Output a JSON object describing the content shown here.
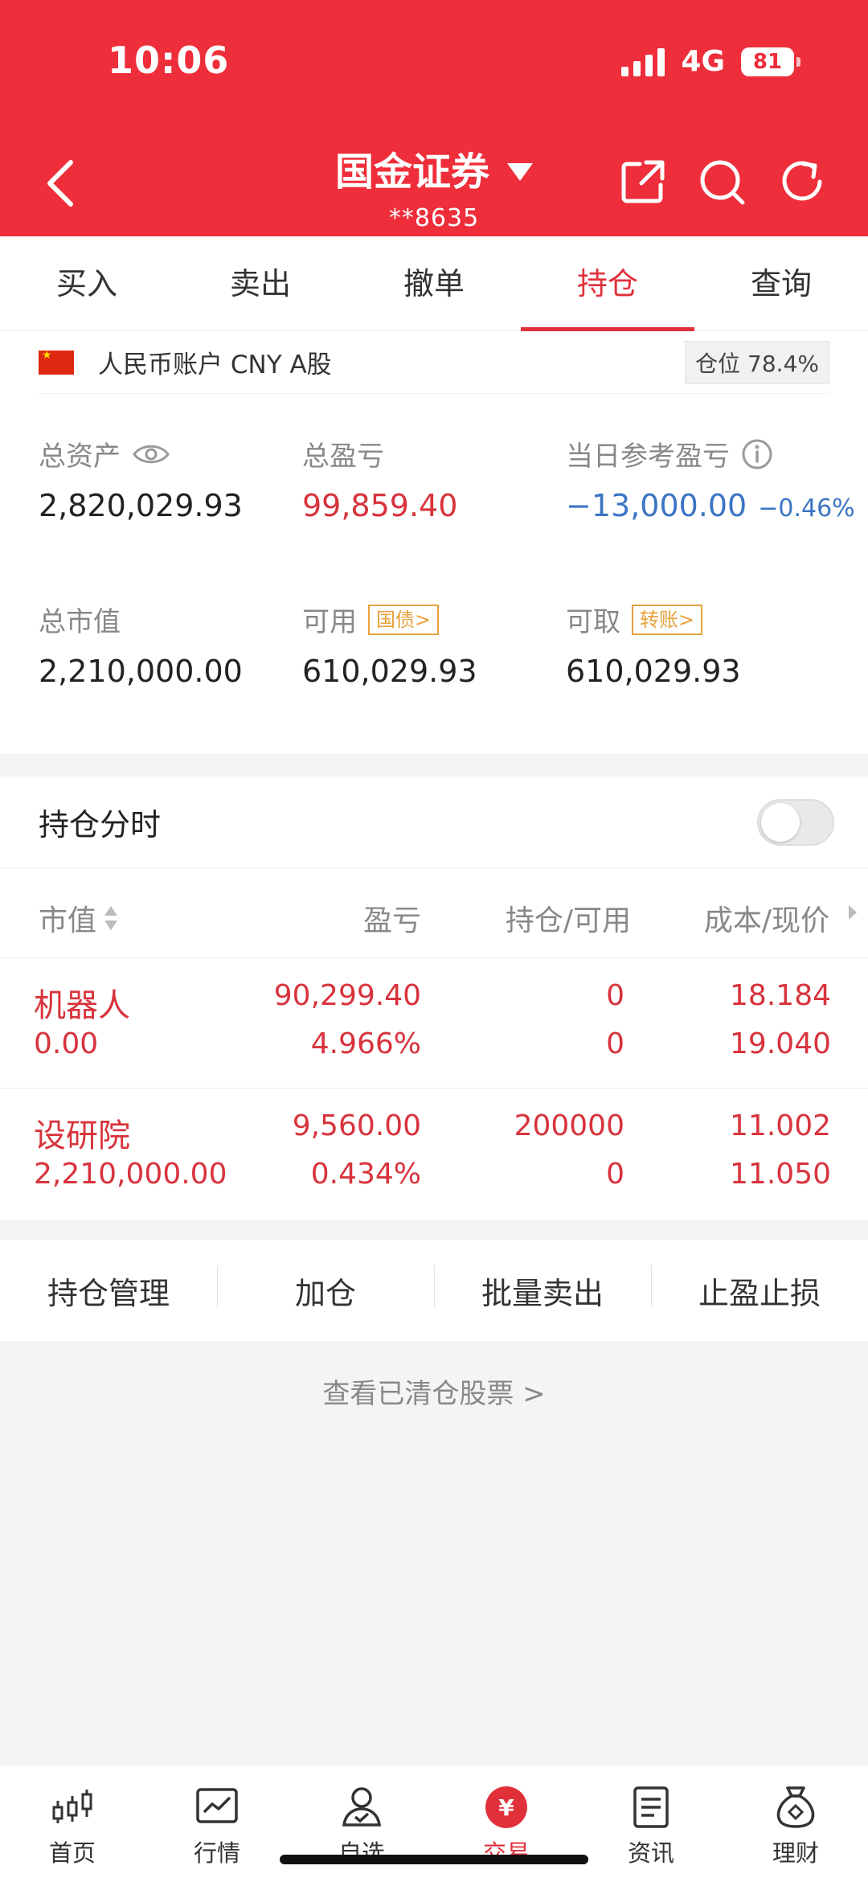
{
  "status_bar": {
    "time": "10:06",
    "network": "4G",
    "battery": "81"
  },
  "header": {
    "title": "国金证券",
    "account_masked": "**8635"
  },
  "tabs": [
    {
      "label": "买入",
      "active": false
    },
    {
      "label": "卖出",
      "active": false
    },
    {
      "label": "撤单",
      "active": false
    },
    {
      "label": "持仓",
      "active": true
    },
    {
      "label": "查询",
      "active": false
    }
  ],
  "account": {
    "name": "人民币账户 CNY A股",
    "position_ratio_label": "仓位 78.4%",
    "metrics": {
      "total_assets_label": "总资产",
      "total_assets": "2,820,029.93",
      "total_pnl_label": "总盈亏",
      "total_pnl": "99,859.40",
      "day_pnl_label": "当日参考盈亏",
      "day_pnl": "−13,000.00",
      "day_pnl_pct": "−0.46%",
      "market_value_label": "总市值",
      "market_value": "2,210,000.00",
      "available_label": "可用",
      "available_tag": "国债>",
      "available": "610,029.93",
      "withdrawable_label": "可取",
      "withdrawable_tag": "转账>",
      "withdrawable": "610,029.93"
    }
  },
  "holdings": {
    "timeshare_label": "持仓分时",
    "timeshare_on": false,
    "columns": [
      "市值",
      "盈亏",
      "持仓/可用",
      "成本/现价"
    ],
    "rows": [
      {
        "name": "机器人",
        "market_value": "0.00",
        "pnl": "90,299.40",
        "pnl_pct": "4.966%",
        "position": "0",
        "available": "0",
        "cost": "18.184",
        "price": "19.040"
      },
      {
        "name": "设研院",
        "market_value": "2,210,000.00",
        "pnl": "9,560.00",
        "pnl_pct": "0.434%",
        "position": "200000",
        "available": "0",
        "cost": "11.002",
        "price": "11.050"
      }
    ]
  },
  "actions": [
    "持仓管理",
    "加仓",
    "批量卖出",
    "止盈止损"
  ],
  "cleared_link": "查看已清仓股票 >",
  "colors": {
    "brand_red": "#ee2e3a",
    "gain_red": "#d8333c",
    "loss_blue": "#3b75c4",
    "tag_orange": "#e6a13a"
  },
  "bottom_nav": [
    {
      "label": "首页",
      "icon": "candlestick-icon",
      "active": false
    },
    {
      "label": "行情",
      "icon": "chart-icon",
      "active": false
    },
    {
      "label": "自选",
      "icon": "user-check-icon",
      "active": false
    },
    {
      "label": "交易",
      "icon": "yuan-icon",
      "active": true
    },
    {
      "label": "资讯",
      "icon": "document-icon",
      "active": false
    },
    {
      "label": "理财",
      "icon": "money-bag-icon",
      "active": false
    }
  ]
}
